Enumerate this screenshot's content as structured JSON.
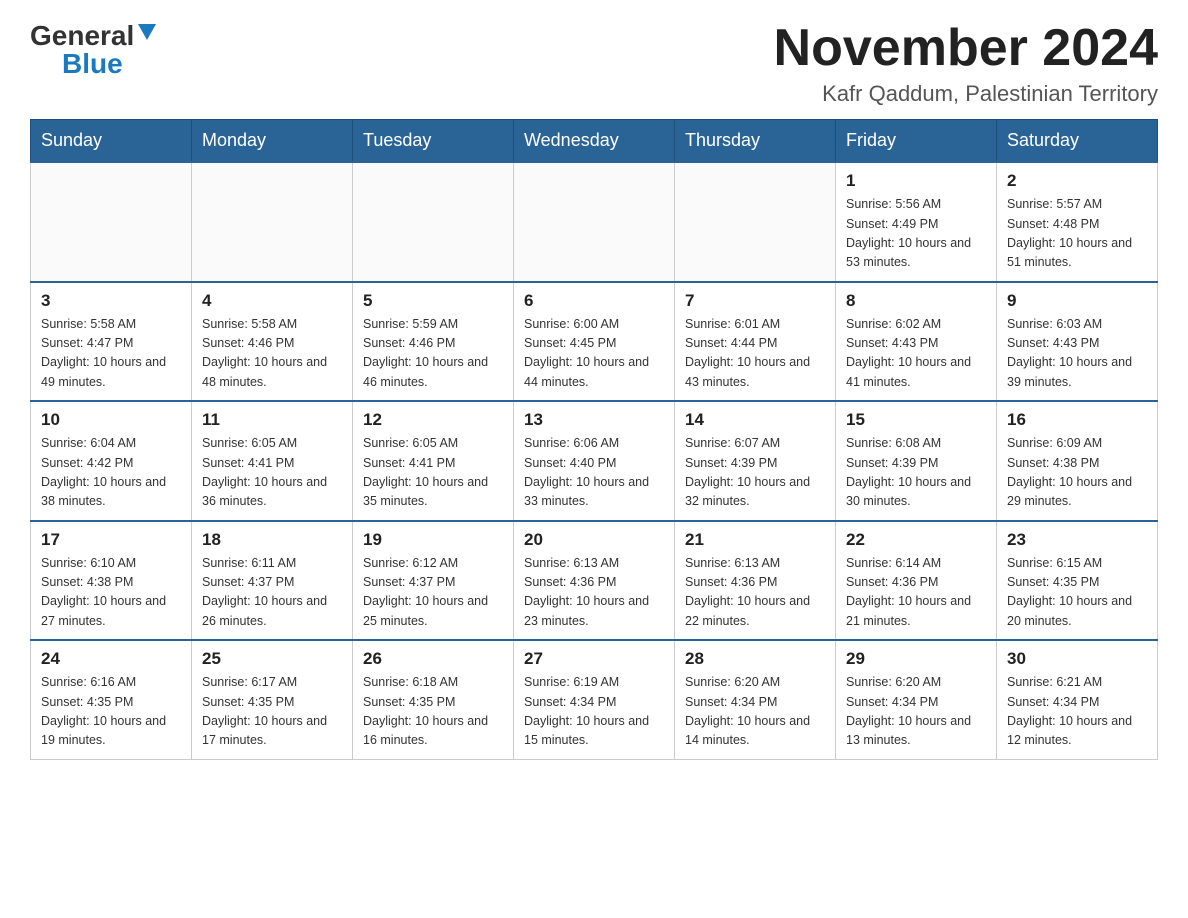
{
  "logo": {
    "general": "General",
    "blue": "Blue"
  },
  "title": "November 2024",
  "location": "Kafr Qaddum, Palestinian Territory",
  "days_of_week": [
    "Sunday",
    "Monday",
    "Tuesday",
    "Wednesday",
    "Thursday",
    "Friday",
    "Saturday"
  ],
  "weeks": [
    [
      {
        "day": "",
        "info": ""
      },
      {
        "day": "",
        "info": ""
      },
      {
        "day": "",
        "info": ""
      },
      {
        "day": "",
        "info": ""
      },
      {
        "day": "",
        "info": ""
      },
      {
        "day": "1",
        "info": "Sunrise: 5:56 AM\nSunset: 4:49 PM\nDaylight: 10 hours\nand 53 minutes."
      },
      {
        "day": "2",
        "info": "Sunrise: 5:57 AM\nSunset: 4:48 PM\nDaylight: 10 hours\nand 51 minutes."
      }
    ],
    [
      {
        "day": "3",
        "info": "Sunrise: 5:58 AM\nSunset: 4:47 PM\nDaylight: 10 hours\nand 49 minutes."
      },
      {
        "day": "4",
        "info": "Sunrise: 5:58 AM\nSunset: 4:46 PM\nDaylight: 10 hours\nand 48 minutes."
      },
      {
        "day": "5",
        "info": "Sunrise: 5:59 AM\nSunset: 4:46 PM\nDaylight: 10 hours\nand 46 minutes."
      },
      {
        "day": "6",
        "info": "Sunrise: 6:00 AM\nSunset: 4:45 PM\nDaylight: 10 hours\nand 44 minutes."
      },
      {
        "day": "7",
        "info": "Sunrise: 6:01 AM\nSunset: 4:44 PM\nDaylight: 10 hours\nand 43 minutes."
      },
      {
        "day": "8",
        "info": "Sunrise: 6:02 AM\nSunset: 4:43 PM\nDaylight: 10 hours\nand 41 minutes."
      },
      {
        "day": "9",
        "info": "Sunrise: 6:03 AM\nSunset: 4:43 PM\nDaylight: 10 hours\nand 39 minutes."
      }
    ],
    [
      {
        "day": "10",
        "info": "Sunrise: 6:04 AM\nSunset: 4:42 PM\nDaylight: 10 hours\nand 38 minutes."
      },
      {
        "day": "11",
        "info": "Sunrise: 6:05 AM\nSunset: 4:41 PM\nDaylight: 10 hours\nand 36 minutes."
      },
      {
        "day": "12",
        "info": "Sunrise: 6:05 AM\nSunset: 4:41 PM\nDaylight: 10 hours\nand 35 minutes."
      },
      {
        "day": "13",
        "info": "Sunrise: 6:06 AM\nSunset: 4:40 PM\nDaylight: 10 hours\nand 33 minutes."
      },
      {
        "day": "14",
        "info": "Sunrise: 6:07 AM\nSunset: 4:39 PM\nDaylight: 10 hours\nand 32 minutes."
      },
      {
        "day": "15",
        "info": "Sunrise: 6:08 AM\nSunset: 4:39 PM\nDaylight: 10 hours\nand 30 minutes."
      },
      {
        "day": "16",
        "info": "Sunrise: 6:09 AM\nSunset: 4:38 PM\nDaylight: 10 hours\nand 29 minutes."
      }
    ],
    [
      {
        "day": "17",
        "info": "Sunrise: 6:10 AM\nSunset: 4:38 PM\nDaylight: 10 hours\nand 27 minutes."
      },
      {
        "day": "18",
        "info": "Sunrise: 6:11 AM\nSunset: 4:37 PM\nDaylight: 10 hours\nand 26 minutes."
      },
      {
        "day": "19",
        "info": "Sunrise: 6:12 AM\nSunset: 4:37 PM\nDaylight: 10 hours\nand 25 minutes."
      },
      {
        "day": "20",
        "info": "Sunrise: 6:13 AM\nSunset: 4:36 PM\nDaylight: 10 hours\nand 23 minutes."
      },
      {
        "day": "21",
        "info": "Sunrise: 6:13 AM\nSunset: 4:36 PM\nDaylight: 10 hours\nand 22 minutes."
      },
      {
        "day": "22",
        "info": "Sunrise: 6:14 AM\nSunset: 4:36 PM\nDaylight: 10 hours\nand 21 minutes."
      },
      {
        "day": "23",
        "info": "Sunrise: 6:15 AM\nSunset: 4:35 PM\nDaylight: 10 hours\nand 20 minutes."
      }
    ],
    [
      {
        "day": "24",
        "info": "Sunrise: 6:16 AM\nSunset: 4:35 PM\nDaylight: 10 hours\nand 19 minutes."
      },
      {
        "day": "25",
        "info": "Sunrise: 6:17 AM\nSunset: 4:35 PM\nDaylight: 10 hours\nand 17 minutes."
      },
      {
        "day": "26",
        "info": "Sunrise: 6:18 AM\nSunset: 4:35 PM\nDaylight: 10 hours\nand 16 minutes."
      },
      {
        "day": "27",
        "info": "Sunrise: 6:19 AM\nSunset: 4:34 PM\nDaylight: 10 hours\nand 15 minutes."
      },
      {
        "day": "28",
        "info": "Sunrise: 6:20 AM\nSunset: 4:34 PM\nDaylight: 10 hours\nand 14 minutes."
      },
      {
        "day": "29",
        "info": "Sunrise: 6:20 AM\nSunset: 4:34 PM\nDaylight: 10 hours\nand 13 minutes."
      },
      {
        "day": "30",
        "info": "Sunrise: 6:21 AM\nSunset: 4:34 PM\nDaylight: 10 hours\nand 12 minutes."
      }
    ]
  ]
}
